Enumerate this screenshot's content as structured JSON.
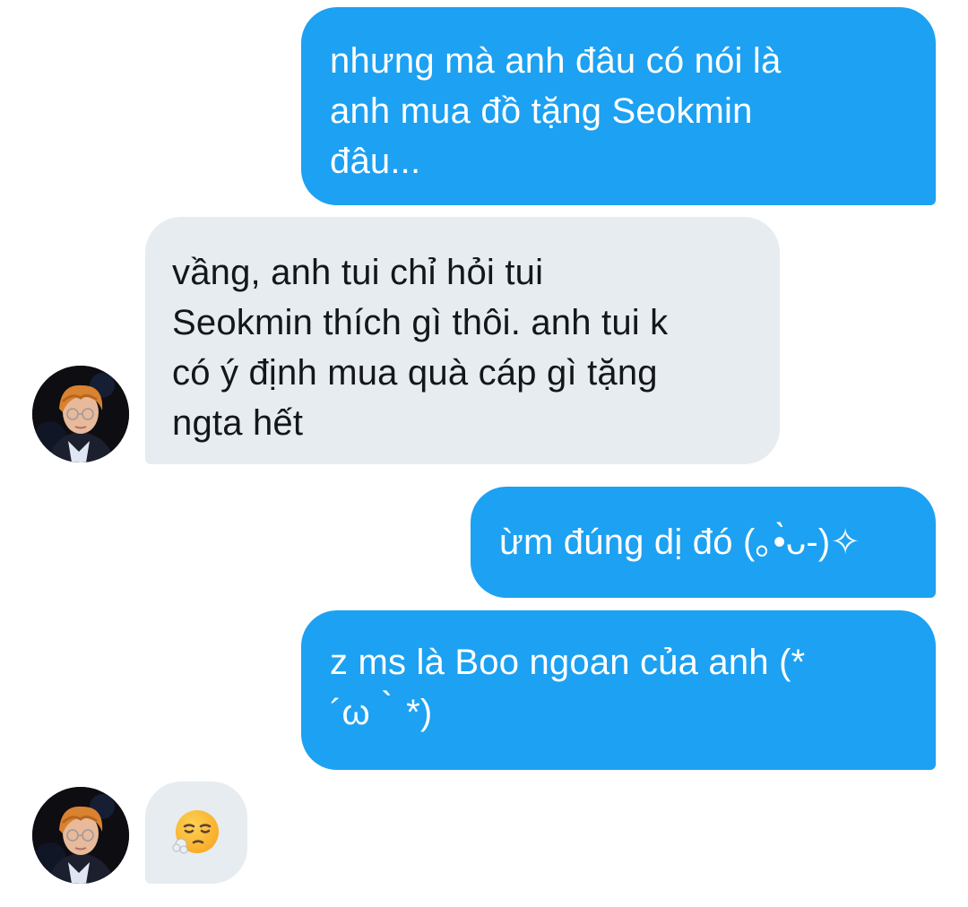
{
  "messages": [
    {
      "sender": "me",
      "text": "nhưng mà anh đâu có nói là\nanh mua đồ tặng Seokmin\nđâu..."
    },
    {
      "sender": "other",
      "text": "vầng, anh tui chỉ hỏi tui\nSeokmin thích gì thôi. anh tui k\ncó ý định mua quà cáp gì tặng\nngta hết"
    },
    {
      "sender": "me",
      "text": "ừm đúng dị đó (｡•̀ᴗ-)✧"
    },
    {
      "sender": "me",
      "text": "z ms là Boo ngoan của anh (*\n´ω｀*)"
    },
    {
      "sender": "other",
      "emoji": "face-exhaling-emoji"
    }
  ],
  "colors": {
    "sent_bubble": "#1da1f2",
    "received_bubble": "#e6ecf0",
    "sent_text": "#ffffff",
    "received_text": "#14171a"
  },
  "icons": {
    "avatar": "user-avatar-photo"
  }
}
